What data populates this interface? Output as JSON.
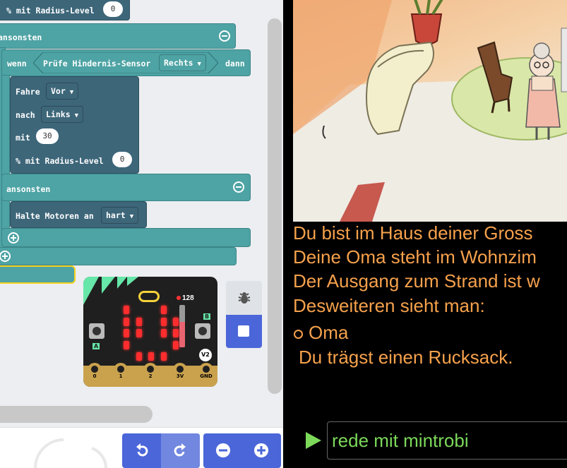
{
  "blocks": {
    "radius_top": {
      "label": "% mit Radius-Level",
      "value": "0"
    },
    "else_1": "ansonsten",
    "if_row": {
      "wenn": "wenn",
      "check": "Prüfe Hindernis-Sensor",
      "side": "Rechts",
      "dann": "dann"
    },
    "drive": {
      "label": "Fahre",
      "value": "Vor"
    },
    "toward": {
      "label": "nach",
      "value": "Links"
    },
    "with": {
      "label": "mit",
      "value": "30"
    },
    "radius": {
      "label": "% mit Radius-Level",
      "value": "0"
    },
    "else_2": "ansonsten",
    "stop": {
      "label": "Halte Motoren an",
      "value": "hart"
    }
  },
  "simulator": {
    "sound_value": "128",
    "pins": [
      "0",
      "1",
      "2",
      "3V",
      "GND"
    ],
    "version": "V2",
    "button_a": "A",
    "button_b": "B"
  },
  "icons": [
    "debug-bug-icon",
    "stop-square-icon",
    "undo-icon",
    "redo-icon",
    "zoom-out-icon",
    "zoom-in-icon",
    "play-arrow-icon"
  ],
  "game": {
    "lines": [
      "Du bist im Haus deiner Gross",
      "Deine Oma steht im Wohnzim",
      "Der Ausgang zum Strand ist w",
      "Desweiteren sieht man:"
    ],
    "items": [
      "Oma"
    ],
    "inventory_line": "Du trägst einen Rucksack.",
    "command_value": "rede mit mintrobi"
  },
  "colors": {
    "teal_block": "#4ea3a4",
    "dark_block": "#3d6679",
    "toolbar_blue": "#4b66d9",
    "story_text": "#f6a14c",
    "command_text": "#7cd95a"
  }
}
